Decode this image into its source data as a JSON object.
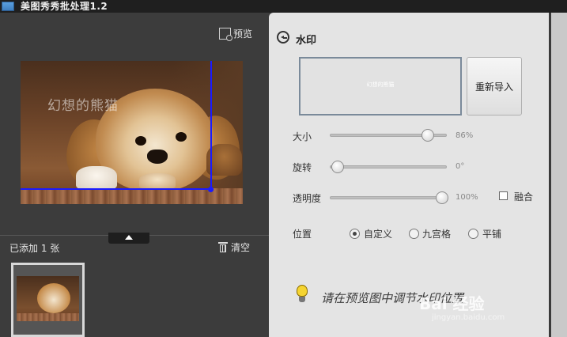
{
  "window": {
    "title": "美图秀秀批处理1.2"
  },
  "left_panel": {
    "preview_label": "预览",
    "image_watermark_text": "幻想的熊猫",
    "added_count_label": "已添加 1 张",
    "clear_label": "清空"
  },
  "right_panel": {
    "title": "水印",
    "watermark_preview_text": "幻想的熊猫",
    "reimport_label": "重新导入",
    "size": {
      "label": "大小",
      "value": "86%",
      "level": 0.86
    },
    "rotate": {
      "label": "旋转",
      "value": "0°",
      "level": 0.0
    },
    "opacity": {
      "label": "透明度",
      "value": "100%",
      "level": 1.0
    },
    "merge_label": "融合",
    "merge_checked": false,
    "position": {
      "label": "位置",
      "options": [
        "自定义",
        "九宫格",
        "平铺"
      ],
      "selected": "自定义"
    },
    "hint_text": "请在预览图中调节水印位置"
  },
  "overlay": {
    "brand": "Bai 经验",
    "site": "jingyan.baidu.com"
  },
  "colors": {
    "title_bar": "#1f1f1f",
    "left_bg": "#3c3c3c",
    "right_bg": "#e4e4e4",
    "guide_line": "#1a1aff"
  }
}
